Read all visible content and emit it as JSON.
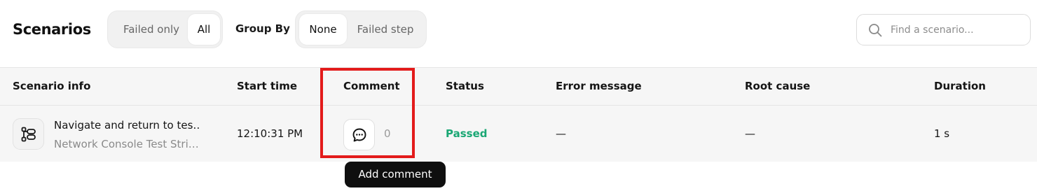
{
  "header": {
    "title": "Scenarios",
    "filter": {
      "options": [
        "Failed only",
        "All"
      ],
      "selected": "All"
    },
    "group_by": {
      "label": "Group By",
      "options": [
        "None",
        "Failed step"
      ],
      "selected": "None"
    },
    "search": {
      "placeholder": "Find a scenario...",
      "value": "",
      "icon": "search-icon"
    }
  },
  "table": {
    "columns": [
      "Scenario info",
      "Start time",
      "Comment",
      "Status",
      "Error message",
      "Root cause",
      "Duration"
    ],
    "rows": [
      {
        "icon": "scenario-flow-icon",
        "name": "Navigate and return to tes…",
        "suite": "Network Console Test Stri…",
        "start_time": "12:10:31 PM",
        "comment_count": "0",
        "status": "Passed",
        "error_message": "—",
        "root_cause": "—",
        "duration": "1 s"
      }
    ]
  },
  "tooltip": {
    "text": "Add comment"
  },
  "colors": {
    "status_passed": "#1aa774",
    "highlight": "#e31b1b",
    "tooltip_bg": "#0f0f0f"
  }
}
